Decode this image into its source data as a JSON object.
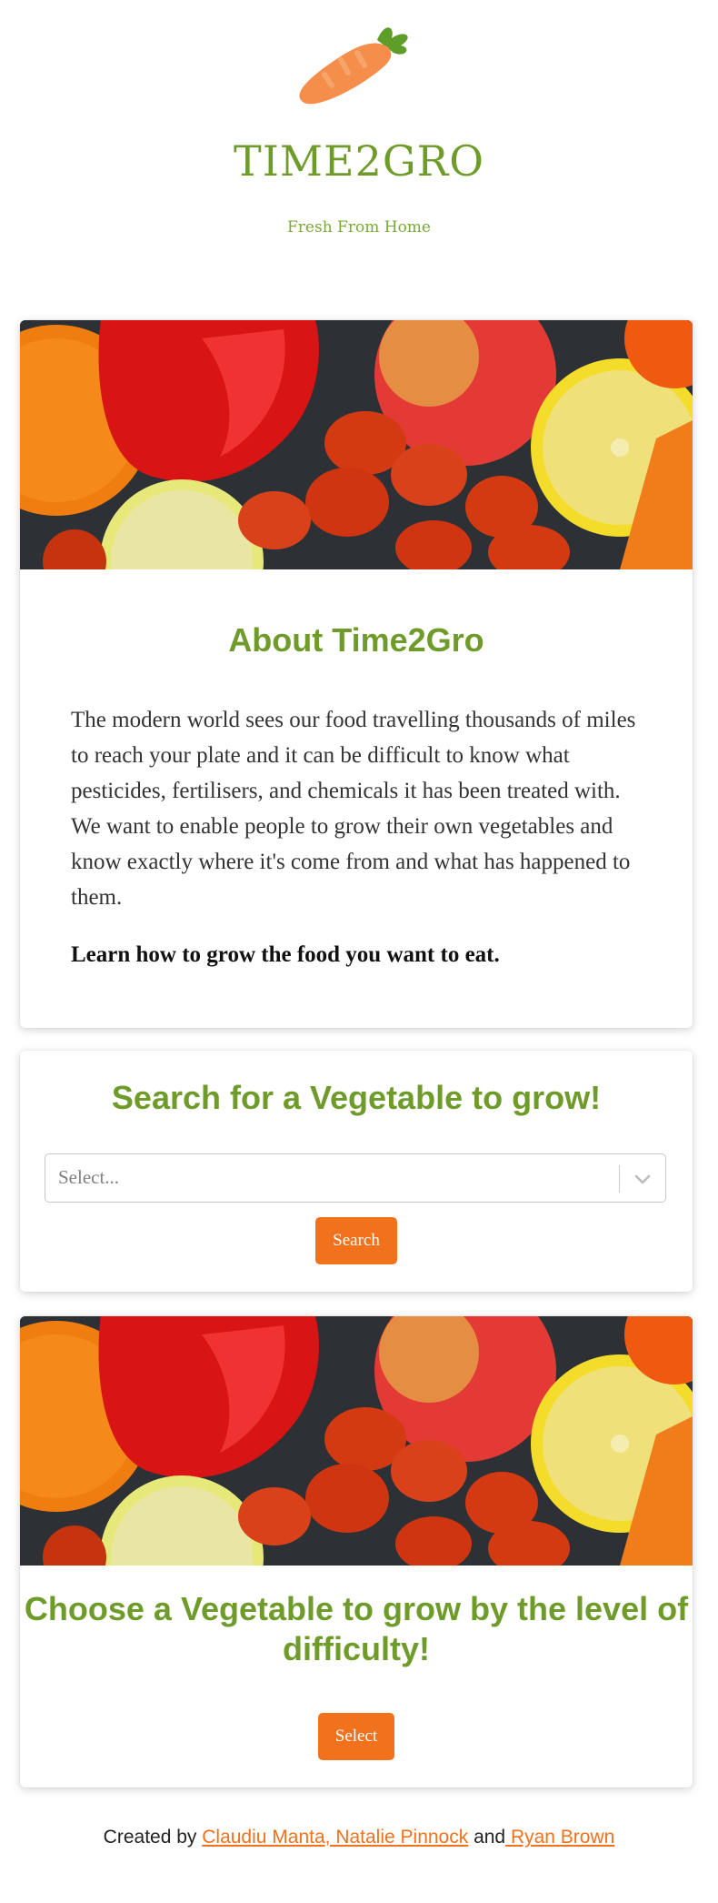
{
  "header": {
    "logo_icon": "carrot-icon",
    "title": "TIME2GRO",
    "tagline": "Fresh From Home"
  },
  "about": {
    "image": "vegetables-photo",
    "heading": "About Time2Gro",
    "body": "The modern world sees our food travelling thousands of miles to reach your plate and it can be difficult to know what pesticides, fertilisers, and chemicals it has been treated with. We want to enable people to grow their own vegetables and know exactly where it's come from and what has happened to them.",
    "strong": "Learn how to grow the food you want to eat."
  },
  "search": {
    "heading": "Search for a Vegetable to grow!",
    "select_placeholder": "Select...",
    "button_label": "Search"
  },
  "choose": {
    "image": "vegetables-photo",
    "heading": "Choose a Vegetable to grow by the level of difficulty!",
    "button_label": "Select"
  },
  "footer": {
    "prefix": "Created by ",
    "link1": "Claudiu Manta, Natalie Pinnock",
    "middle": " and",
    "link2": " Ryan Brown"
  },
  "colors": {
    "brand_green": "#6f9b2a",
    "accent_orange": "#f2711c"
  }
}
